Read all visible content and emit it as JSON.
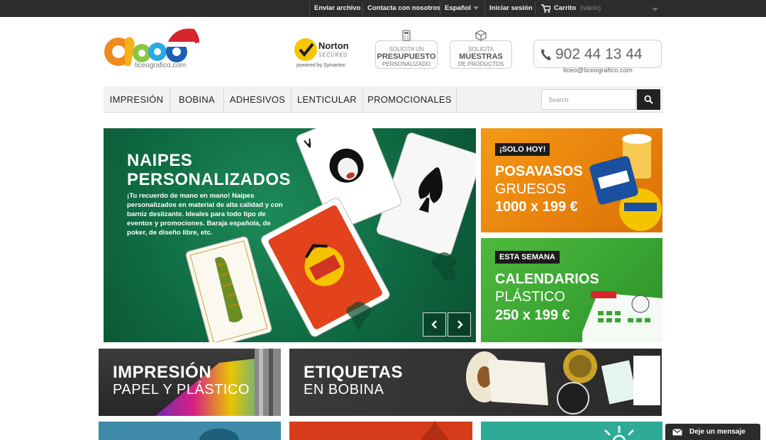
{
  "topbar": {
    "send_file": "Enviar archivo",
    "contact": "Contacta con nosotros",
    "language": "Español",
    "login": "Iniciar sesión",
    "cart": "Carrito",
    "cart_status": "(vacío)"
  },
  "logo": {
    "text": "liceografico.com",
    "icon": "liceo-logo-with-santa-hat"
  },
  "badges": {
    "norton_name": "Norton",
    "norton_secured": "SECURED",
    "norton_powered": "powered by Symantec",
    "quote_line1": "SOLICITA UN",
    "quote_line2": "PRESUPUESTO",
    "quote_line3": "PERSONALIZADO",
    "samples_line1": "SOLICITA",
    "samples_line2": "MUESTRAS",
    "samples_line3": "DE PRODUCTOS"
  },
  "contact": {
    "phone": "902 44 13 44",
    "email": "liceo@liceografico.com"
  },
  "nav": {
    "items": [
      "IMPRESIÓN",
      "BOBINA",
      "ADHESIVOS",
      "LENTICULAR",
      "PROMOCIONALES"
    ],
    "search_placeholder": "Search"
  },
  "slider": {
    "title": "NAIPES PERSONALIZADOS",
    "description": "¡Tu recuerdo de mano en mano! Naipes personalizados en material de alta calidad y con barniz deslizante. Ideales para todo tipo de eventos y promociones. Baraja española, de poker, de diseño libre, etc."
  },
  "promos": [
    {
      "tag": "¡SOLO HOY!",
      "title": "POSAVASOS",
      "subtitle": "GRUESOS",
      "price": "1000 x 199 €",
      "color": "#e8820c"
    },
    {
      "tag": "ESTA SEMANA",
      "title": "CALENDARIOS",
      "subtitle": "PLÁSTICO",
      "price": "250 x 199 €",
      "color": "#3aa533"
    }
  ],
  "categories": [
    {
      "title": "IMPRESIÓN",
      "subtitle": "PAPEL Y PLÁSTICO"
    },
    {
      "title": "ETIQUETAS",
      "subtitle": "EN BOBINA"
    }
  ],
  "chat": {
    "label": "Deje un mensaje"
  },
  "colors": {
    "topbar": "#2c2c2c",
    "accent_orange": "#e8820c",
    "accent_green": "#3aa533",
    "dark": "#222222"
  }
}
